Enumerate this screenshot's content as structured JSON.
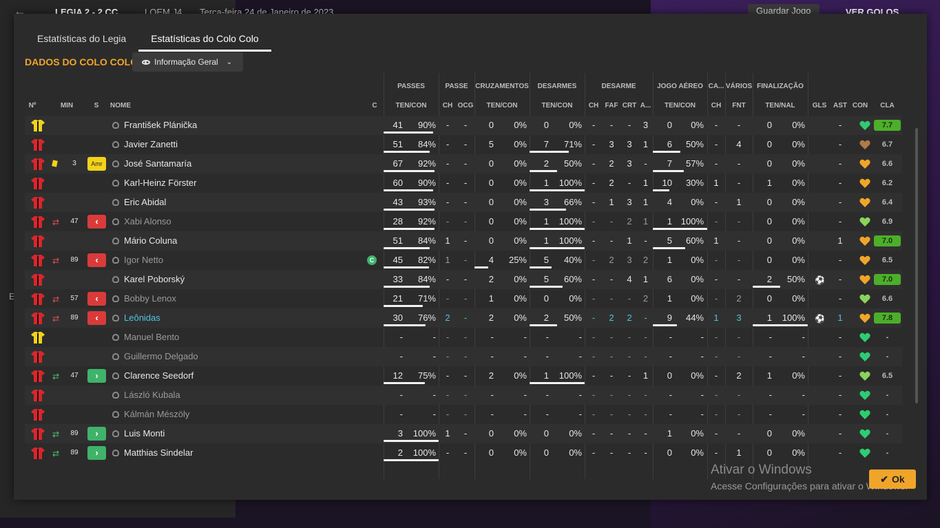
{
  "topbar": {
    "back": "←",
    "score": "LEGIA 2 - 2 CC",
    "competition": "LOEM J4",
    "date": "Terça-feira 24 de Janeiro de 2023",
    "save": "Guardar Jogo",
    "ver": "VER GOLOS"
  },
  "left_letter": "E",
  "tabs": [
    "Estatísticas do Legia",
    "Estatísticas do Colo Colo"
  ],
  "section_title": "DADOS DO COLO COLO",
  "view_dropdown": "Informação Geral",
  "groups": {
    "passes": "PASSES",
    "passe": "PASSE",
    "cruz": "CRUZAMENTOS",
    "desarmes": "DESARMES",
    "desarme": "DESARME",
    "aereo": "JOGO AÉREO",
    "ca": "CA...",
    "varios": "VÁRIOS",
    "final": "FINALIZAÇÃO"
  },
  "headers": {
    "no": "Nº",
    "min": "MIN",
    "s": "S",
    "nome": "NOME",
    "c": "C",
    "passes": "TEN/CON",
    "passe_ch": "CH",
    "passe_ocg": "OCG",
    "cruz": "TEN/CON",
    "des": "TEN/CON",
    "d_ch": "CH",
    "d_faf": "FAF",
    "d_crt": "CRT",
    "d_a": "A...",
    "aereo": "TEN/CON",
    "ca_ch": "CH",
    "var_fnt": "FNT",
    "final": "TEN/NAL",
    "gls": "GLS",
    "ast": "AST",
    "con": "CON",
    "cla": "CLA"
  },
  "rows": [
    {
      "shirt": "yellow",
      "sub": "",
      "min": "",
      "badge": "",
      "name": "František Plánička",
      "dim": false,
      "link": false,
      "cap": false,
      "pa": "41",
      "pp": "90%",
      "pf": 0.9,
      "pch": "-",
      "pocg": "-",
      "ca": "0",
      "cp": "0%",
      "cf": 0,
      "da": "0",
      "dp": "0%",
      "df": 0,
      "dch": "-",
      "dfaf": "-",
      "dcrt": "-",
      "da2": "3",
      "aa": "0",
      "ap": "0%",
      "af": 0,
      "cach": "-",
      "fnt": "-",
      "fa": "0",
      "fp": "0%",
      "ff": 0,
      "ball": false,
      "ast": "-",
      "heart": "green",
      "cla": "7.7",
      "good": true
    },
    {
      "shirt": "red",
      "sub": "",
      "min": "",
      "badge": "",
      "name": "Javier Zanetti",
      "dim": false,
      "link": false,
      "cap": false,
      "pa": "51",
      "pp": "84%",
      "pf": 0.84,
      "pch": "-",
      "pocg": "-",
      "ca": "5",
      "cp": "0%",
      "cf": 0,
      "da": "7",
      "dp": "71%",
      "df": 0.71,
      "dch": "-",
      "dfaf": "3",
      "dcrt": "3",
      "da2": "1",
      "aa": "6",
      "ap": "50%",
      "af": 0.5,
      "cach": "-",
      "fnt": "4",
      "fa": "0",
      "fp": "0%",
      "ff": 0,
      "ball": false,
      "ast": "-",
      "heart": "brown",
      "cla": "6.7",
      "good": false
    },
    {
      "shirt": "red",
      "sub": "ycard",
      "min": "3",
      "badge": "Amr",
      "name": "José Santamaría",
      "dim": false,
      "link": false,
      "cap": false,
      "pa": "67",
      "pp": "92%",
      "pf": 0.92,
      "pch": "-",
      "pocg": "-",
      "ca": "0",
      "cp": "0%",
      "cf": 0,
      "da": "2",
      "dp": "50%",
      "df": 0.5,
      "dch": "-",
      "dfaf": "2",
      "dcrt": "3",
      "da2": "-",
      "aa": "7",
      "ap": "57%",
      "af": 0.57,
      "cach": "-",
      "fnt": "-",
      "fa": "0",
      "fp": "0%",
      "ff": 0,
      "ball": false,
      "ast": "-",
      "heart": "orange",
      "cla": "6.6",
      "good": false
    },
    {
      "shirt": "red",
      "sub": "",
      "min": "",
      "badge": "",
      "name": "Karl-Heinz Förster",
      "dim": false,
      "link": false,
      "cap": false,
      "pa": "60",
      "pp": "90%",
      "pf": 0.9,
      "pch": "-",
      "pocg": "-",
      "ca": "0",
      "cp": "0%",
      "cf": 0,
      "da": "1",
      "dp": "100%",
      "df": 1,
      "dch": "-",
      "dfaf": "2",
      "dcrt": "-",
      "da2": "1",
      "aa": "10",
      "ap": "30%",
      "af": 0.3,
      "cach": "1",
      "fnt": "-",
      "fa": "1",
      "fp": "0%",
      "ff": 0,
      "ball": false,
      "ast": "-",
      "heart": "orange",
      "cla": "6.2",
      "good": false
    },
    {
      "shirt": "red",
      "sub": "",
      "min": "",
      "badge": "",
      "name": "Eric Abidal",
      "dim": false,
      "link": false,
      "cap": false,
      "pa": "43",
      "pp": "93%",
      "pf": 0.93,
      "pch": "-",
      "pocg": "-",
      "ca": "0",
      "cp": "0%",
      "cf": 0,
      "da": "3",
      "dp": "66%",
      "df": 0.66,
      "dch": "-",
      "dfaf": "1",
      "dcrt": "3",
      "da2": "1",
      "aa": "4",
      "ap": "0%",
      "af": 0,
      "cach": "-",
      "fnt": "1",
      "fa": "0",
      "fp": "0%",
      "ff": 0,
      "ball": false,
      "ast": "-",
      "heart": "orange",
      "cla": "6.4",
      "good": false
    },
    {
      "shirt": "red",
      "sub": "out",
      "min": "47",
      "badge": "out",
      "name": "Xabi Alonso",
      "dim": true,
      "link": false,
      "cap": false,
      "pa": "28",
      "pp": "92%",
      "pf": 0.92,
      "pch": "-",
      "pocg": "-",
      "ca": "0",
      "cp": "0%",
      "cf": 0,
      "da": "1",
      "dp": "100%",
      "df": 1,
      "dch": "-",
      "dfaf": "-",
      "dcrt": "2",
      "da2": "1",
      "aa": "1",
      "ap": "100%",
      "af": 1,
      "cach": "-",
      "fnt": "-",
      "fa": "0",
      "fp": "0%",
      "ff": 0,
      "ball": false,
      "ast": "-",
      "heart": "lime",
      "cla": "6.9",
      "good": false
    },
    {
      "shirt": "red",
      "sub": "",
      "min": "",
      "badge": "",
      "name": "Mário Coluna",
      "dim": false,
      "link": false,
      "cap": false,
      "pa": "51",
      "pp": "84%",
      "pf": 0.84,
      "pch": "1",
      "pocg": "-",
      "ca": "0",
      "cp": "0%",
      "cf": 0,
      "da": "1",
      "dp": "100%",
      "df": 1,
      "dch": "-",
      "dfaf": "-",
      "dcrt": "1",
      "da2": "-",
      "aa": "5",
      "ap": "60%",
      "af": 0.6,
      "cach": "1",
      "fnt": "-",
      "fa": "0",
      "fp": "0%",
      "ff": 0,
      "ball": false,
      "ast": "1",
      "heart": "orange",
      "cla": "7.0",
      "good": true
    },
    {
      "shirt": "red",
      "sub": "out",
      "min": "89",
      "badge": "out",
      "name": "Igor Netto",
      "dim": true,
      "link": false,
      "cap": true,
      "pa": "45",
      "pp": "82%",
      "pf": 0.82,
      "pch": "1",
      "pocg": "-",
      "ca": "4",
      "cp": "25%",
      "cf": 0.25,
      "da": "5",
      "dp": "40%",
      "df": 0.4,
      "dch": "-",
      "dfaf": "2",
      "dcrt": "3",
      "da2": "2",
      "aa": "1",
      "ap": "0%",
      "af": 0,
      "cach": "-",
      "fnt": "-",
      "fa": "0",
      "fp": "0%",
      "ff": 0,
      "ball": false,
      "ast": "-",
      "heart": "orange",
      "cla": "6.5",
      "good": false
    },
    {
      "shirt": "red",
      "sub": "",
      "min": "",
      "badge": "",
      "name": "Karel Poborský",
      "dim": false,
      "link": false,
      "cap": false,
      "pa": "33",
      "pp": "84%",
      "pf": 0.84,
      "pch": "-",
      "pocg": "-",
      "ca": "2",
      "cp": "0%",
      "cf": 0,
      "da": "5",
      "dp": "60%",
      "df": 0.6,
      "dch": "-",
      "dfaf": "-",
      "dcrt": "4",
      "da2": "1",
      "aa": "6",
      "ap": "0%",
      "af": 0,
      "cach": "-",
      "fnt": "-",
      "fa": "2",
      "fp": "50%",
      "ff": 0.5,
      "ball": true,
      "ast": "-",
      "heart": "orange",
      "cla": "7.0",
      "good": true
    },
    {
      "shirt": "red",
      "sub": "out",
      "min": "57",
      "badge": "out",
      "name": "Bobby Lenox",
      "dim": true,
      "link": false,
      "cap": false,
      "pa": "21",
      "pp": "71%",
      "pf": 0.71,
      "pch": "-",
      "pocg": "-",
      "ca": "1",
      "cp": "0%",
      "cf": 0,
      "da": "0",
      "dp": "0%",
      "df": 0,
      "dch": "-",
      "dfaf": "-",
      "dcrt": "-",
      "da2": "2",
      "aa": "1",
      "ap": "0%",
      "af": 0,
      "cach": "-",
      "fnt": "2",
      "fa": "0",
      "fp": "0%",
      "ff": 0,
      "ball": false,
      "ast": "-",
      "heart": "lime",
      "cla": "6.6",
      "good": false
    },
    {
      "shirt": "red",
      "sub": "out",
      "min": "89",
      "badge": "out",
      "name": "Leônidas",
      "dim": false,
      "link": true,
      "cap": false,
      "pa": "30",
      "pp": "76%",
      "pf": 0.76,
      "pch": "2",
      "pocg": "-",
      "ca": "2",
      "cp": "0%",
      "cf": 0,
      "da": "2",
      "dp": "50%",
      "df": 0.5,
      "dch": "-",
      "dfaf": "2",
      "dcrt": "2",
      "da2": "-",
      "aa": "9",
      "ap": "44%",
      "af": 0.44,
      "cach": "1",
      "fnt": "3",
      "fa": "1",
      "fp": "100%",
      "ff": 1,
      "ball": true,
      "ast": "1",
      "heart": "orange",
      "cla": "7.8",
      "good": true
    },
    {
      "shirt": "yellow",
      "sub": "",
      "min": "",
      "badge": "",
      "name": "Manuel Bento",
      "dim": true,
      "link": false,
      "cap": false,
      "pa": "-",
      "pp": "-",
      "pf": 0,
      "pch": "-",
      "pocg": "-",
      "ca": "-",
      "cp": "-",
      "cf": 0,
      "da": "-",
      "dp": "-",
      "df": 0,
      "dch": "-",
      "dfaf": "-",
      "dcrt": "-",
      "da2": "-",
      "aa": "-",
      "ap": "-",
      "af": 0,
      "cach": "-",
      "fnt": "-",
      "fa": "-",
      "fp": "-",
      "ff": 0,
      "ball": false,
      "ast": "-",
      "heart": "green",
      "cla": "-",
      "good": false
    },
    {
      "shirt": "red",
      "sub": "",
      "min": "",
      "badge": "",
      "name": "Guillermo Delgado",
      "dim": true,
      "link": false,
      "cap": false,
      "pa": "-",
      "pp": "-",
      "pf": 0,
      "pch": "-",
      "pocg": "-",
      "ca": "-",
      "cp": "-",
      "cf": 0,
      "da": "-",
      "dp": "-",
      "df": 0,
      "dch": "-",
      "dfaf": "-",
      "dcrt": "-",
      "da2": "-",
      "aa": "-",
      "ap": "-",
      "af": 0,
      "cach": "-",
      "fnt": "-",
      "fa": "-",
      "fp": "-",
      "ff": 0,
      "ball": false,
      "ast": "-",
      "heart": "green",
      "cla": "-",
      "good": false
    },
    {
      "shirt": "red",
      "sub": "in",
      "min": "47",
      "badge": "in",
      "name": "Clarence Seedorf",
      "dim": false,
      "link": false,
      "cap": false,
      "pa": "12",
      "pp": "75%",
      "pf": 0.75,
      "pch": "-",
      "pocg": "-",
      "ca": "2",
      "cp": "0%",
      "cf": 0,
      "da": "1",
      "dp": "100%",
      "df": 1,
      "dch": "-",
      "dfaf": "-",
      "dcrt": "-",
      "da2": "1",
      "aa": "0",
      "ap": "0%",
      "af": 0,
      "cach": "-",
      "fnt": "2",
      "fa": "1",
      "fp": "0%",
      "ff": 0,
      "ball": false,
      "ast": "-",
      "heart": "lime",
      "cla": "6.5",
      "good": false
    },
    {
      "shirt": "red",
      "sub": "",
      "min": "",
      "badge": "",
      "name": "László Kubala",
      "dim": true,
      "link": false,
      "cap": false,
      "pa": "-",
      "pp": "-",
      "pf": 0,
      "pch": "-",
      "pocg": "-",
      "ca": "-",
      "cp": "-",
      "cf": 0,
      "da": "-",
      "dp": "-",
      "df": 0,
      "dch": "-",
      "dfaf": "-",
      "dcrt": "-",
      "da2": "-",
      "aa": "-",
      "ap": "-",
      "af": 0,
      "cach": "-",
      "fnt": "-",
      "fa": "-",
      "fp": "-",
      "ff": 0,
      "ball": false,
      "ast": "-",
      "heart": "green",
      "cla": "-",
      "good": false
    },
    {
      "shirt": "red",
      "sub": "",
      "min": "",
      "badge": "",
      "name": "Kálmán Mészöly",
      "dim": true,
      "link": false,
      "cap": false,
      "pa": "-",
      "pp": "-",
      "pf": 0,
      "pch": "-",
      "pocg": "-",
      "ca": "-",
      "cp": "-",
      "cf": 0,
      "da": "-",
      "dp": "-",
      "df": 0,
      "dch": "-",
      "dfaf": "-",
      "dcrt": "-",
      "da2": "-",
      "aa": "-",
      "ap": "-",
      "af": 0,
      "cach": "-",
      "fnt": "-",
      "fa": "-",
      "fp": "-",
      "ff": 0,
      "ball": false,
      "ast": "-",
      "heart": "green",
      "cla": "-",
      "good": false
    },
    {
      "shirt": "red",
      "sub": "in",
      "min": "89",
      "badge": "in",
      "name": "Luis Monti",
      "dim": false,
      "link": false,
      "cap": false,
      "pa": "3",
      "pp": "100%",
      "pf": 1,
      "pch": "1",
      "pocg": "-",
      "ca": "0",
      "cp": "0%",
      "cf": 0,
      "da": "0",
      "dp": "0%",
      "df": 0,
      "dch": "-",
      "dfaf": "-",
      "dcrt": "-",
      "da2": "-",
      "aa": "1",
      "ap": "0%",
      "af": 0,
      "cach": "-",
      "fnt": "-",
      "fa": "0",
      "fp": "0%",
      "ff": 0,
      "ball": false,
      "ast": "-",
      "heart": "green",
      "cla": "-",
      "good": false
    },
    {
      "shirt": "red",
      "sub": "in",
      "min": "89",
      "badge": "in",
      "name": "Matthias Sindelar",
      "dim": false,
      "link": false,
      "cap": false,
      "pa": "2",
      "pp": "100%",
      "pf": 1,
      "pch": "-",
      "pocg": "-",
      "ca": "0",
      "cp": "0%",
      "cf": 0,
      "da": "0",
      "dp": "0%",
      "df": 0,
      "dch": "-",
      "dfaf": "-",
      "dcrt": "-",
      "da2": "-",
      "aa": "0",
      "ap": "0%",
      "af": 0,
      "cach": "-",
      "fnt": "1",
      "fa": "0",
      "fp": "0%",
      "ff": 0,
      "ball": false,
      "ast": "-",
      "heart": "green",
      "cla": "-",
      "good": false
    }
  ],
  "colors": {
    "accent": "#f0a52a",
    "link": "#4fc3e0",
    "rating_good": "#4caf2a",
    "heart_green": "#2ecc71",
    "heart_lime": "#8bd35a",
    "heart_orange": "#f0a52a",
    "heart_brown": "#b07a4a"
  },
  "watermark": {
    "line1": "Ativar o Windows",
    "line2": "Acesse Configurações para ativar o Windows."
  },
  "ok_label": "Ok"
}
